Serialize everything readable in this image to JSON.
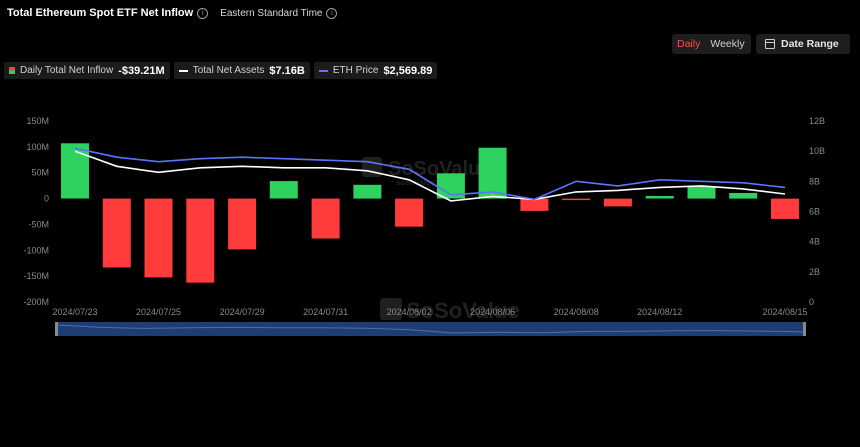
{
  "header": {
    "title": "Total Ethereum Spot ETF Net Inflow",
    "subtitle": "Eastern Standard Time"
  },
  "controls": {
    "daily": "Daily",
    "weekly": "Weekly",
    "date_range": "Date Range"
  },
  "legend": [
    {
      "label": "Daily Total Net Inflow",
      "value": "-$39.21M"
    },
    {
      "label": "Total Net Assets",
      "value": "$7.16B"
    },
    {
      "label": "ETH Price",
      "value": "$2,569.89"
    }
  ],
  "watermark": {
    "name": "SoSoValue",
    "url": "sosovalue.com"
  },
  "colors": {
    "positive": "#2ed25f",
    "negative": "#ff3b3b",
    "assets_line": "#ffffff",
    "price_line": "#5b74ff",
    "navigator": "#1e3d73"
  },
  "chart_data": {
    "type": "bar",
    "x": [
      "2024/07/23",
      "2024/07/24",
      "2024/07/25",
      "2024/07/26",
      "2024/07/29",
      "2024/07/30",
      "2024/07/31",
      "2024/08/01",
      "2024/08/02",
      "2024/08/05",
      "2024/08/06",
      "2024/08/07",
      "2024/08/08",
      "2024/08/09",
      "2024/08/12",
      "2024/08/13",
      "2024/08/14",
      "2024/08/15"
    ],
    "x_tick_labels": [
      "2024/07/23",
      "2024/07/25",
      "2024/07/29",
      "2024/07/31",
      "2024/08/02",
      "2024/08/06",
      "2024/08/08",
      "2024/08/12",
      "2024/08/15"
    ],
    "series": [
      {
        "name": "Daily Total Net Inflow",
        "axis": "left",
        "type": "bar",
        "values": [
          106.8,
          -133.2,
          -152.4,
          -162.7,
          -98.3,
          33.7,
          -77.2,
          26.7,
          -54.3,
          48.8,
          98.4,
          -23.7,
          -2.9,
          -15.1,
          4.9,
          24.3,
          10.8,
          -39.2
        ]
      },
      {
        "name": "Total Net Assets",
        "axis": "right",
        "type": "line",
        "values": [
          10.0,
          9.0,
          8.6,
          8.9,
          9.0,
          8.9,
          8.9,
          8.7,
          8.1,
          6.7,
          7.0,
          6.8,
          7.3,
          7.4,
          7.6,
          7.7,
          7.5,
          7.16
        ]
      },
      {
        "name": "ETH Price",
        "axis": "right",
        "type": "line",
        "values": [
          10.2,
          9.6,
          9.3,
          9.5,
          9.6,
          9.5,
          9.4,
          9.3,
          8.8,
          7.1,
          7.3,
          6.8,
          8.0,
          7.7,
          8.1,
          8.0,
          7.9,
          7.6
        ]
      }
    ],
    "y_left": {
      "ticks": [
        "150M",
        "100M",
        "50M",
        "0",
        "-50M",
        "-100M",
        "-150M",
        "-200M"
      ],
      "range": [
        -200,
        150
      ]
    },
    "y_right": {
      "ticks": [
        "12B",
        "10B",
        "8B",
        "6B",
        "4B",
        "2B",
        "0"
      ],
      "range": [
        0,
        12
      ]
    },
    "grid": false,
    "legend_position": "top-left"
  }
}
